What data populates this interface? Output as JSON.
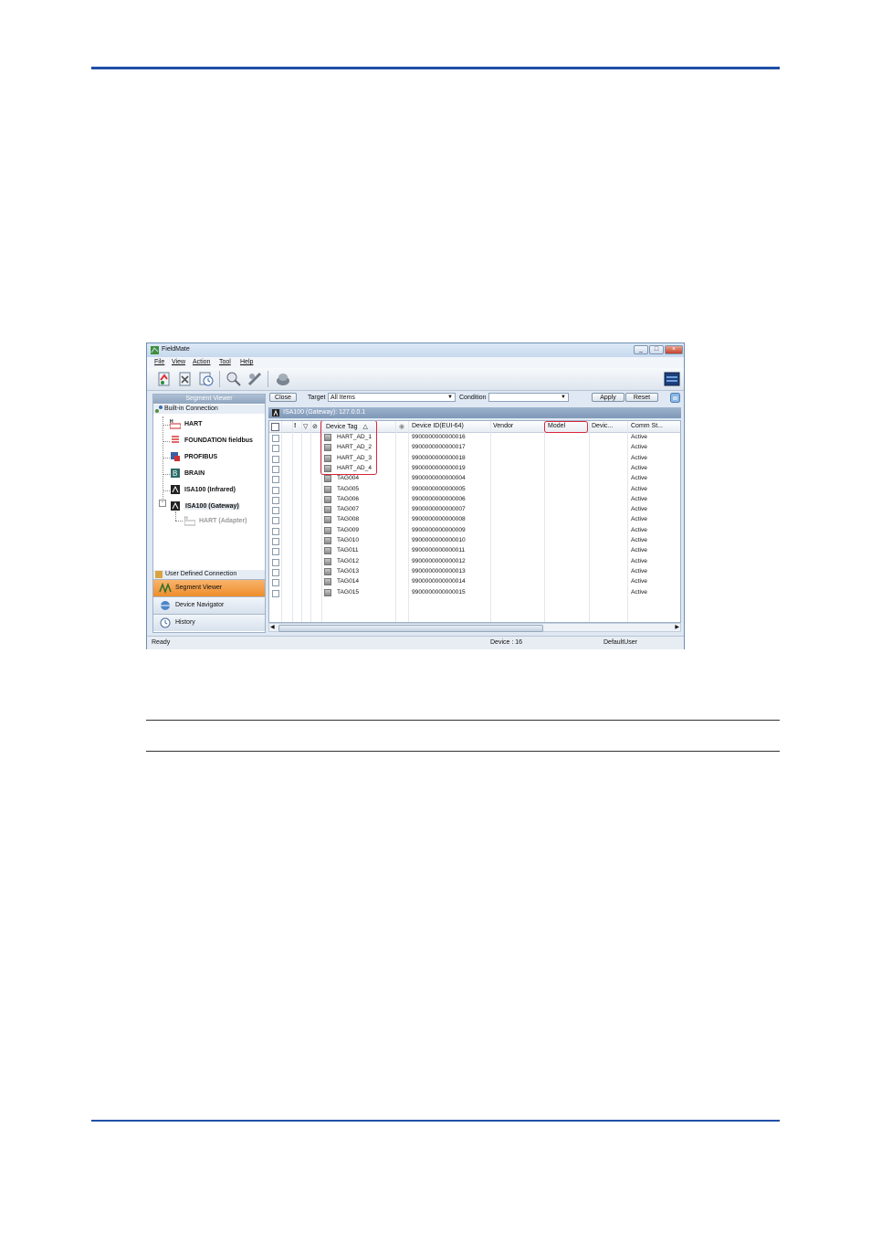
{
  "window": {
    "title": "FieldMate",
    "controls": [
      "_",
      "□",
      "×"
    ]
  },
  "menu": [
    "File",
    "View",
    "Action",
    "Tool",
    "Help"
  ],
  "left_pane": {
    "header": "Segment Viewer",
    "section": "Built-in Connection",
    "tree": [
      {
        "label": "HART"
      },
      {
        "label": "FOUNDATION fieldbus"
      },
      {
        "label": "PROFIBUS"
      },
      {
        "label": "BRAIN"
      },
      {
        "label": "ISA100 (Infrared)"
      },
      {
        "label": "ISA100 (Gateway)"
      },
      {
        "label": "HART (Adapter)"
      }
    ],
    "user_defined": "User Defined Connection",
    "nav": [
      {
        "label": "Segment Viewer"
      },
      {
        "label": "Device Navigator"
      },
      {
        "label": "History"
      }
    ]
  },
  "filter": {
    "close_label": "Close",
    "target_label": "Target",
    "target_value": "All Items",
    "condition_label": "Condition",
    "condition_value": "",
    "apply_label": "Apply",
    "reset_label": "Reset"
  },
  "gateway_bar": "ISA100 (Gateway): 127.0.0.1",
  "grid": {
    "columns": [
      "Device Tag",
      "Device ID(EUI-64)",
      "Vendor",
      "Model",
      "Devic...",
      "Comm St..."
    ],
    "sort_glyph": "△",
    "rows": [
      {
        "tag": "HART_AD_1",
        "id": "9900000000000016",
        "status": "Active"
      },
      {
        "tag": "HART_AD_2",
        "id": "9900000000000017",
        "status": "Active"
      },
      {
        "tag": "HART_AD_3",
        "id": "9900000000000018",
        "status": "Active"
      },
      {
        "tag": "HART_AD_4",
        "id": "9900000000000019",
        "status": "Active"
      },
      {
        "tag": "TAG004",
        "id": "9900000000000004",
        "status": "Active"
      },
      {
        "tag": "TAG005",
        "id": "9900000000000005",
        "status": "Active"
      },
      {
        "tag": "TAG006",
        "id": "9900000000000006",
        "status": "Active"
      },
      {
        "tag": "TAG007",
        "id": "9900000000000007",
        "status": "Active"
      },
      {
        "tag": "TAG008",
        "id": "9900000000000008",
        "status": "Active"
      },
      {
        "tag": "TAG009",
        "id": "9900000000000009",
        "status": "Active"
      },
      {
        "tag": "TAG010",
        "id": "9900000000000010",
        "status": "Active"
      },
      {
        "tag": "TAG011",
        "id": "9900000000000011",
        "status": "Active"
      },
      {
        "tag": "TAG012",
        "id": "9900000000000012",
        "status": "Active"
      },
      {
        "tag": "TAG013",
        "id": "9900000000000013",
        "status": "Active"
      },
      {
        "tag": "TAG014",
        "id": "9900000000000014",
        "status": "Active"
      },
      {
        "tag": "TAG015",
        "id": "9900000000000015",
        "status": "Active"
      }
    ]
  },
  "statusbar": {
    "left": "Ready",
    "device_count": "Device : 16",
    "user": "DefaultUser"
  },
  "colors": {
    "rule": "#1f4fa6",
    "highlight": "#d9263a",
    "selected_nav": "#ef8d2b"
  }
}
